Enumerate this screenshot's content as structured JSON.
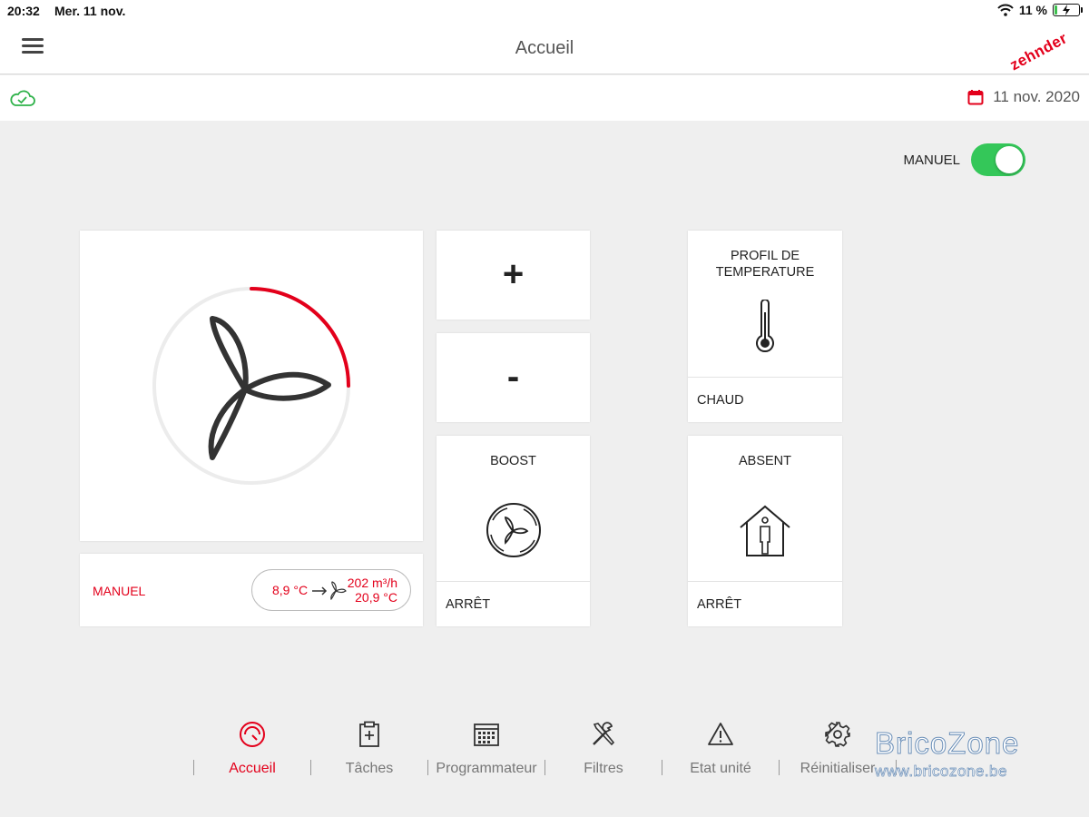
{
  "statusbar": {
    "time": "20:32",
    "date": "Mer. 11 nov.",
    "battery": "11 %",
    "battery_level": 0.11
  },
  "navbar": {
    "title": "Accueil",
    "logo": "zehnder"
  },
  "infobar": {
    "date": "11 nov. 2020"
  },
  "mode_toggle": {
    "label": "MANUEL",
    "on": true
  },
  "fan": {
    "speed_level": 0.25
  },
  "status": {
    "mode": "MANUEL",
    "outdoor_temp": "8,9 °C",
    "flow": "202 m³/h",
    "supply_temp": "20,9 °C"
  },
  "controls": {
    "plus": "+",
    "minus": "-"
  },
  "boost": {
    "title": "BOOST",
    "state": "ARRÊT"
  },
  "profile": {
    "title_line1": "PROFIL DE",
    "title_line2": "TEMPERATURE",
    "state": "CHAUD"
  },
  "absent": {
    "title": "ABSENT",
    "state": "ARRÊT"
  },
  "tabs": [
    {
      "label": "Accueil",
      "icon": "gauge-icon"
    },
    {
      "label": "Tâches",
      "icon": "clipboard-plus-icon"
    },
    {
      "label": "Programmateur",
      "icon": "calendar-grid-icon"
    },
    {
      "label": "Filtres",
      "icon": "tools-icon"
    },
    {
      "label": "Etat unité",
      "icon": "warning-icon"
    },
    {
      "label": "Réinitialiser",
      "icon": "gear-icon"
    }
  ],
  "watermark": {
    "line1": "BricoZone",
    "line2": "www.bricozone.be"
  },
  "colors": {
    "accent": "#e3001b",
    "toggle": "#34c759",
    "cloud": "#2fb24a"
  }
}
